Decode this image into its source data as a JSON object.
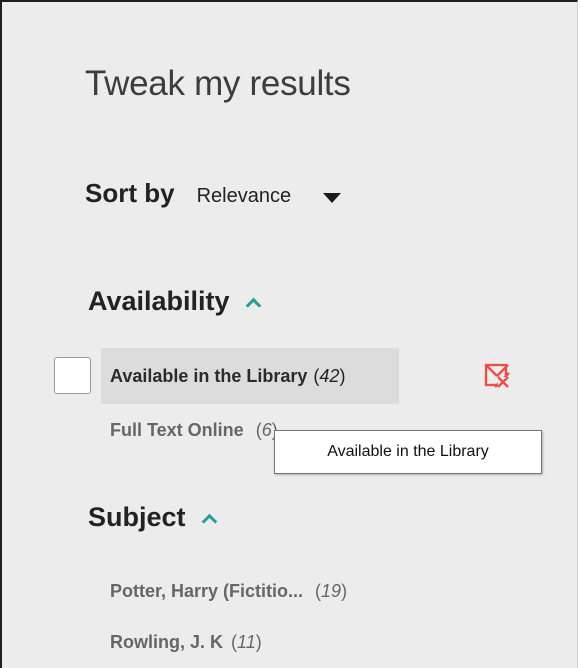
{
  "panel": {
    "title": "Tweak my results"
  },
  "sort": {
    "label": "Sort by",
    "value": "Relevance",
    "caret_icon": "caret-down-icon"
  },
  "availability": {
    "title": "Availability",
    "toggle_icon": "chevron-up-icon",
    "items": [
      {
        "label": "Available in the Library",
        "count": "42",
        "selected": false
      },
      {
        "label": "Full Text Online",
        "count": "6"
      }
    ],
    "exclude_icon": "exclude-filter-icon",
    "tooltip": "Available in the Library"
  },
  "subject": {
    "title": "Subject",
    "toggle_icon": "chevron-up-icon",
    "items": [
      {
        "label": "Potter, Harry (Fictitio...",
        "count": "19"
      },
      {
        "label": "Rowling, J. K",
        "count": "11"
      }
    ]
  },
  "colors": {
    "accent": "#2a9d99",
    "exclude": "#e8504a",
    "panel_bg": "#ececec"
  }
}
